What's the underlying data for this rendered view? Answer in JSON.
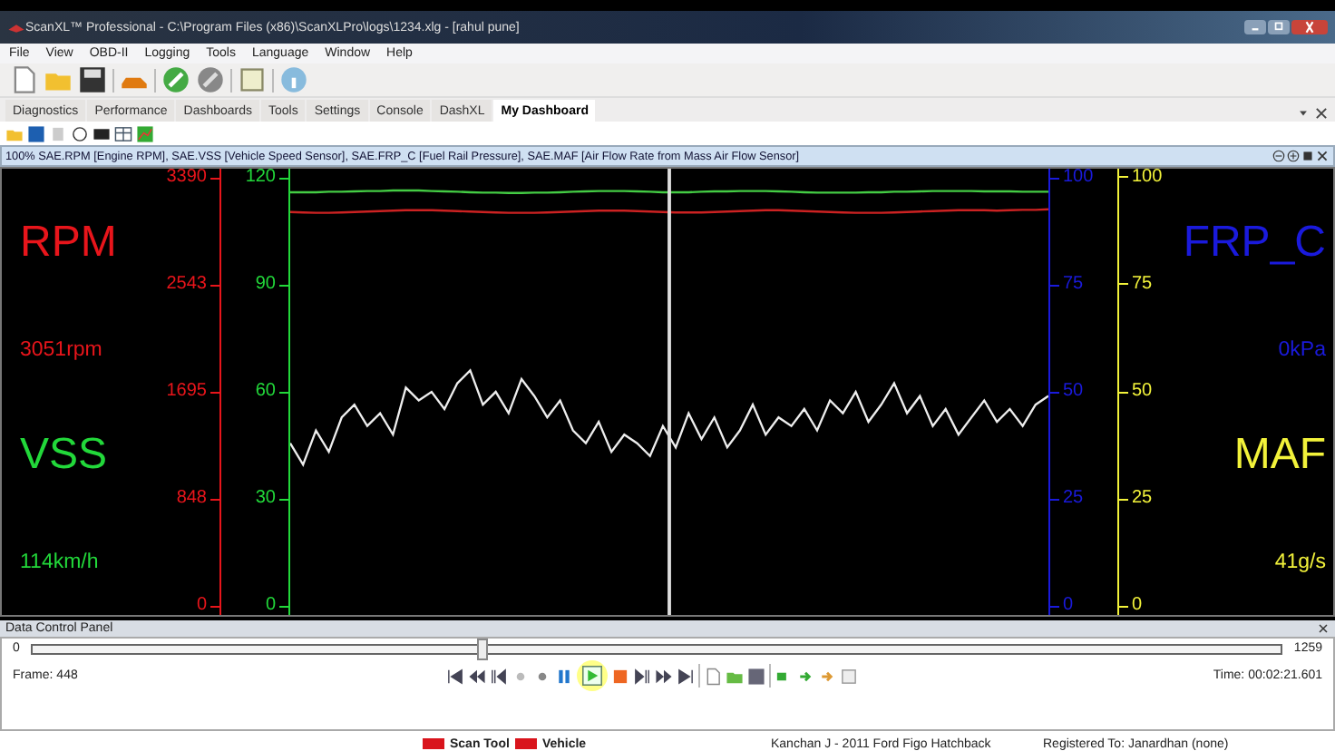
{
  "window": {
    "title": "ScanXL™ Professional - C:\\Program Files (x86)\\ScanXLPro\\logs\\1234.xlg - [rahul pune]"
  },
  "menu": [
    "File",
    "View",
    "OBD-II",
    "Logging",
    "Tools",
    "Language",
    "Window",
    "Help"
  ],
  "tabs": [
    {
      "label": "Diagnostics",
      "selected": false
    },
    {
      "label": "Performance",
      "selected": false
    },
    {
      "label": "Dashboards",
      "selected": false
    },
    {
      "label": "Tools",
      "selected": false
    },
    {
      "label": "Settings",
      "selected": false
    },
    {
      "label": "Console",
      "selected": false
    },
    {
      "label": "DashXL",
      "selected": false
    },
    {
      "label": "My Dashboard",
      "selected": true
    }
  ],
  "graph": {
    "header": "100% SAE.RPM [Engine RPM], SAE.VSS [Vehicle Speed Sensor], SAE.FRP_C [Fuel Rail Pressure], SAE.MAF [Air Flow Rate from Mass Air Flow Sensor]",
    "left_gauges": [
      {
        "name": "RPM",
        "value": "3051rpm",
        "color": "#e8151b"
      },
      {
        "name": "VSS",
        "value": "114km/h",
        "color": "#22d83a"
      }
    ],
    "right_gauges": [
      {
        "name": "FRP_C",
        "value": "0kPa",
        "color": "#1a1adc"
      },
      {
        "name": "MAF",
        "value": "41g/s",
        "color": "#f2f23a"
      }
    ],
    "left_axes": [
      {
        "color": "#e8151b",
        "ticks": [
          "3390",
          "2543",
          "1695",
          "848",
          "0"
        ]
      },
      {
        "color": "#22d83a",
        "ticks": [
          "120",
          "90",
          "60",
          "30",
          "0"
        ]
      }
    ],
    "right_axes": [
      {
        "color": "#1a1adc",
        "ticks": [
          "100",
          "75",
          "50",
          "25",
          "0"
        ]
      },
      {
        "color": "#f2f23a"
      }
    ],
    "chart_data": {
      "type": "line",
      "ylim": [
        -2.1,
        102.1
      ],
      "yticks": [
        {
          "value": 0,
          "label": "0"
        },
        {
          "value": 25,
          "label": "25"
        },
        {
          "value": 50,
          "label": "50"
        },
        {
          "value": 75,
          "label": "75"
        },
        {
          "value": 100,
          "label": "100"
        }
      ],
      "series": [
        {
          "color": "#cc2222",
          "values": [
            92,
            91.9,
            91.8,
            91.8,
            91.9,
            92,
            92.1,
            92.2,
            92.3,
            92.4,
            92.4,
            92.4,
            92.3,
            92.2,
            92.1,
            92,
            91.9,
            91.8,
            91.8,
            91.8,
            91.9,
            92,
            92.1,
            92.2,
            92.3,
            92.3,
            92.3,
            92.2,
            92.1,
            92,
            91.9,
            91.9,
            91.9,
            92,
            92.1,
            92.2,
            92.3,
            92.4,
            92.4,
            92.3,
            92.2,
            92.1,
            92,
            91.9,
            91.8,
            91.8,
            91.8,
            91.9,
            92,
            92.1,
            92.2,
            92.3,
            92.4,
            92.4,
            92.4,
            92.3,
            92.4,
            92.5,
            92.5,
            92.6
          ]
        },
        {
          "color": "#44cc44",
          "values": [
            96.6,
            96.6,
            96.6,
            96.7,
            96.7,
            96.8,
            96.9,
            96.9,
            97,
            97,
            97,
            96.9,
            96.8,
            96.7,
            96.6,
            96.5,
            96.5,
            96.4,
            96.4,
            96.5,
            96.5,
            96.6,
            96.7,
            96.8,
            96.9,
            96.9,
            96.9,
            96.8,
            96.7,
            96.6,
            96.6,
            96.6,
            96.7,
            96.8,
            96.8,
            96.9,
            96.9,
            96.9,
            96.8,
            96.7,
            96.6,
            96.5,
            96.5,
            96.5,
            96.5,
            96.6,
            96.6,
            96.7,
            96.7,
            96.8,
            96.9,
            96.9,
            96.9,
            96.9,
            96.8,
            96.8,
            96.8,
            96.7,
            96.7,
            96.7
          ]
        },
        {
          "color": "#eeeeee",
          "values": [
            38,
            33,
            41,
            36,
            44,
            47,
            42,
            45,
            40,
            51,
            48,
            50,
            46,
            52,
            55,
            47,
            50,
            45,
            53,
            49,
            44,
            48,
            41,
            38,
            43,
            36,
            40,
            38,
            35,
            42,
            37,
            45,
            39,
            44,
            37,
            41,
            47,
            40,
            44,
            42,
            46,
            41,
            48,
            45,
            50,
            43,
            47,
            52,
            45,
            49,
            42,
            46,
            40,
            44,
            48,
            43,
            46,
            42,
            47,
            49
          ]
        }
      ]
    }
  },
  "control_panel": {
    "title": "Data Control Panel",
    "min": "0",
    "max": "1259",
    "level": 0.356,
    "frame_label": "Frame:",
    "frame": "448",
    "time_label": "Time:",
    "time": "00:02:21.601"
  },
  "status_bar": {
    "legend": [
      {
        "label": "Scan Tool",
        "color": "#d9141c"
      },
      {
        "label": "Vehicle",
        "color": "#d9141c"
      }
    ],
    "vehicle": "Kanchan J - 2011 Ford Figo Hatchback",
    "registered": "Registered To: Janardhan (none)"
  }
}
